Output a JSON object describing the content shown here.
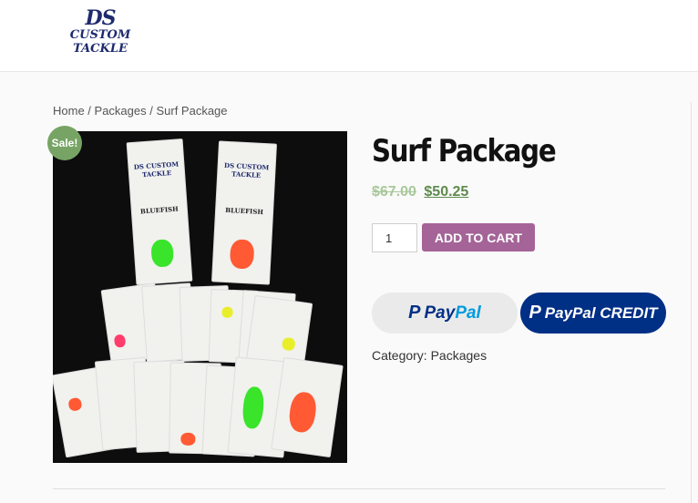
{
  "header": {
    "logo": {
      "line1": "DS",
      "line2": "CUSTOM",
      "line3": "TACKLE"
    }
  },
  "breadcrumb": {
    "home": "Home",
    "sep": " / ",
    "category": "Packages",
    "current": "Surf Package"
  },
  "product": {
    "sale_badge": "Sale!",
    "title": "Surf Package",
    "old_price": "$67.00",
    "new_price": "$50.25",
    "quantity": "1",
    "add_to_cart": "ADD TO CART",
    "paypal": {
      "a": "Pay",
      "b": "Pal"
    },
    "paypal_credit": "PayPal CREDIT",
    "category_label": "Category:",
    "category_value": "Packages",
    "image": {
      "pack_brand": "DS CUSTOM TACKLE",
      "pack_name": "BLUEFISH",
      "colors": {
        "green": "#39e42a",
        "orange": "#ff5a33",
        "yellow": "#e8ef2a",
        "pink": "#ff3d6b"
      }
    }
  },
  "colors": {
    "accent": "#a46497",
    "sale": "#77a464"
  }
}
